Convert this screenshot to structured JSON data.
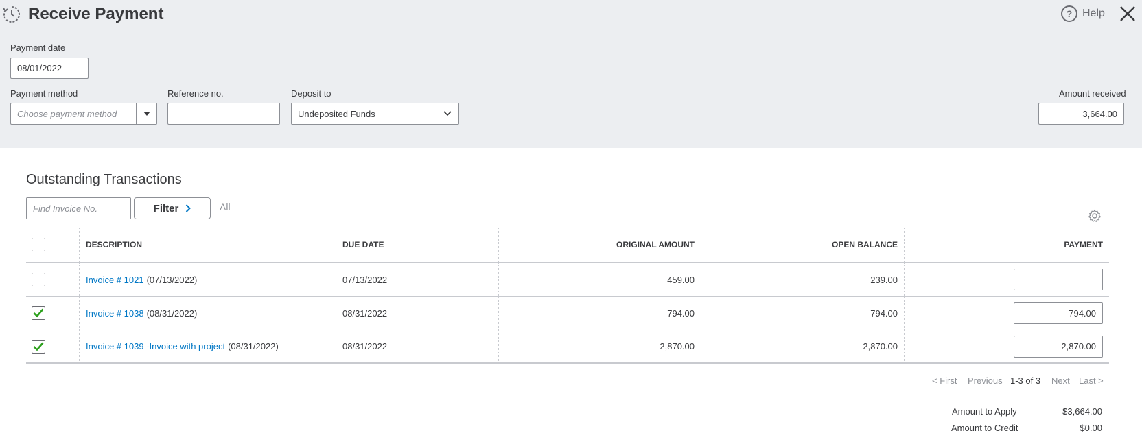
{
  "header": {
    "title": "Receive Payment",
    "help_label": "Help",
    "icons": {
      "app": "receive-payment-icon",
      "help": "help-icon",
      "close": "close-icon"
    }
  },
  "form": {
    "payment_date": {
      "label": "Payment date",
      "value": "08/01/2022"
    },
    "payment_method": {
      "label": "Payment method",
      "placeholder": "Choose payment method"
    },
    "reference_no": {
      "label": "Reference no.",
      "value": ""
    },
    "deposit_to": {
      "label": "Deposit to",
      "value": "Undeposited Funds"
    },
    "amount_received": {
      "label": "Amount received",
      "value": "3,664.00"
    }
  },
  "outstanding": {
    "title": "Outstanding Transactions",
    "find_placeholder": "Find Invoice No.",
    "filter_label": "Filter",
    "filter_value": "All",
    "columns": {
      "description": "DESCRIPTION",
      "due_date": "DUE DATE",
      "original_amount": "ORIGINAL AMOUNT",
      "open_balance": "OPEN BALANCE",
      "payment": "PAYMENT"
    },
    "rows": [
      {
        "checked": false,
        "link": "Invoice # 1021",
        "date_suffix": "(07/13/2022)",
        "due_date": "07/13/2022",
        "original_amount": "459.00",
        "open_balance": "239.00",
        "payment": ""
      },
      {
        "checked": true,
        "link": "Invoice # 1038",
        "date_suffix": "(08/31/2022)",
        "due_date": "08/31/2022",
        "original_amount": "794.00",
        "open_balance": "794.00",
        "payment": "794.00"
      },
      {
        "checked": true,
        "link": "Invoice # 1039 -Invoice with project",
        "date_suffix": "(08/31/2022)",
        "due_date": "08/31/2022",
        "original_amount": "2,870.00",
        "open_balance": "2,870.00",
        "payment": "2,870.00"
      }
    ],
    "pagination": {
      "first": "< First",
      "previous": "Previous",
      "range": "1-3 of 3",
      "next": "Next",
      "last": "Last >"
    }
  },
  "totals": {
    "amount_to_apply": {
      "label": "Amount to Apply",
      "value": "$3,664.00"
    },
    "amount_to_credit": {
      "label": "Amount to Credit",
      "value": "$0.00"
    }
  },
  "colors": {
    "link": "#0077c5",
    "check": "#2ca01c",
    "panel_bg": "#eceef1"
  }
}
